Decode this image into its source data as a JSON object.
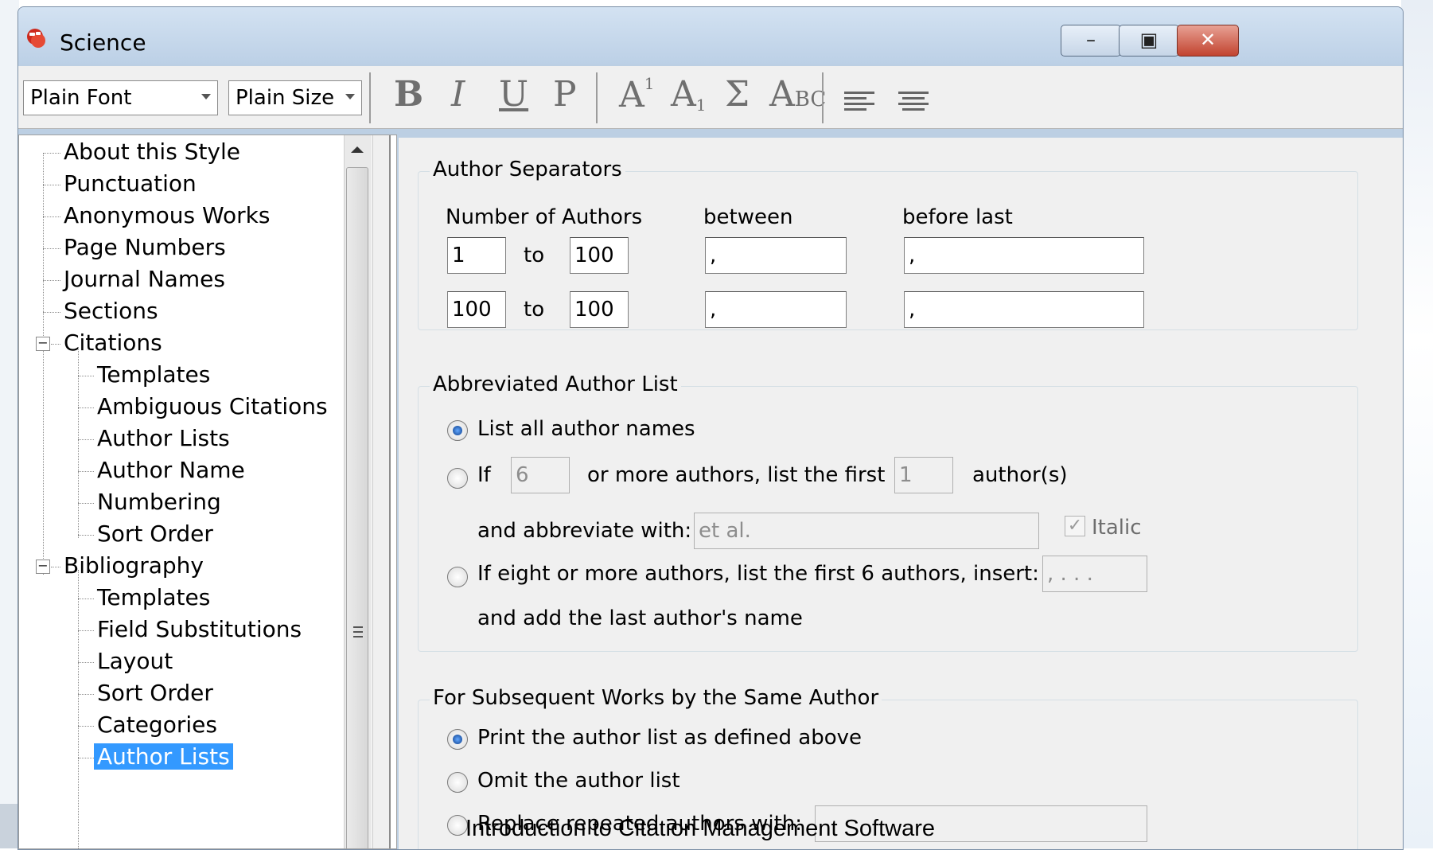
{
  "window": {
    "title": "Science"
  },
  "window_controls": {
    "minimize": "–",
    "maximize": "▣",
    "close": "✕"
  },
  "toolbar": {
    "font_select": "Plain Font",
    "size_select": "Plain Size",
    "bold": "B",
    "italic": "I",
    "underline": "U",
    "plain": "P",
    "superscript_base": "A",
    "superscript_mark": "1",
    "subscript_base": "A",
    "subscript_mark": "1",
    "symbol": "Σ",
    "smallcaps_a": "A",
    "smallcaps_bc": "BC"
  },
  "sidebar": {
    "items": [
      {
        "label": "About this Style"
      },
      {
        "label": "Punctuation"
      },
      {
        "label": "Anonymous Works"
      },
      {
        "label": "Page Numbers"
      },
      {
        "label": "Journal Names"
      },
      {
        "label": "Sections"
      },
      {
        "label": "Citations",
        "expander": "−"
      },
      {
        "label": "Templates"
      },
      {
        "label": "Ambiguous Citations"
      },
      {
        "label": "Author Lists"
      },
      {
        "label": "Author Name"
      },
      {
        "label": "Numbering"
      },
      {
        "label": "Sort Order"
      },
      {
        "label": "Bibliography",
        "expander": "−"
      },
      {
        "label": "Templates"
      },
      {
        "label": "Field Substitutions"
      },
      {
        "label": "Layout"
      },
      {
        "label": "Sort Order"
      },
      {
        "label": "Categories"
      },
      {
        "label": "Author Lists",
        "selected": true
      }
    ]
  },
  "author_separators": {
    "legend": "Author Separators",
    "col_num": "Number of Authors",
    "col_between": "between",
    "col_before_last": "before last",
    "to": "to",
    "rows": [
      {
        "from": "1",
        "to": "100",
        "between": ",",
        "before_last": ","
      },
      {
        "from": "100",
        "to": "100",
        "between": ",",
        "before_last": ","
      }
    ]
  },
  "abbreviated": {
    "legend": "Abbreviated Author List",
    "opt_all": "List all author names",
    "opt_if": "If",
    "if_count": "6",
    "mid_text": "or more authors, list the first",
    "first_count": "1",
    "authors_suffix": "author(s)",
    "abbrev_label": "and abbreviate with:",
    "abbrev_value": "et al.",
    "italic_label": "Italic",
    "italic_check": "✓",
    "opt_eight": "If eight or more authors, list the first 6 authors, insert:",
    "insert_value": ", . . .",
    "add_last": "and add the last author's name"
  },
  "subsequent": {
    "legend": "For Subsequent Works by the Same Author",
    "opt_print": "Print the author list as defined above",
    "opt_omit": "Omit the author list",
    "opt_replace": "Replace repeated authors with:"
  },
  "caption": "Introduction to Citation Management Software"
}
